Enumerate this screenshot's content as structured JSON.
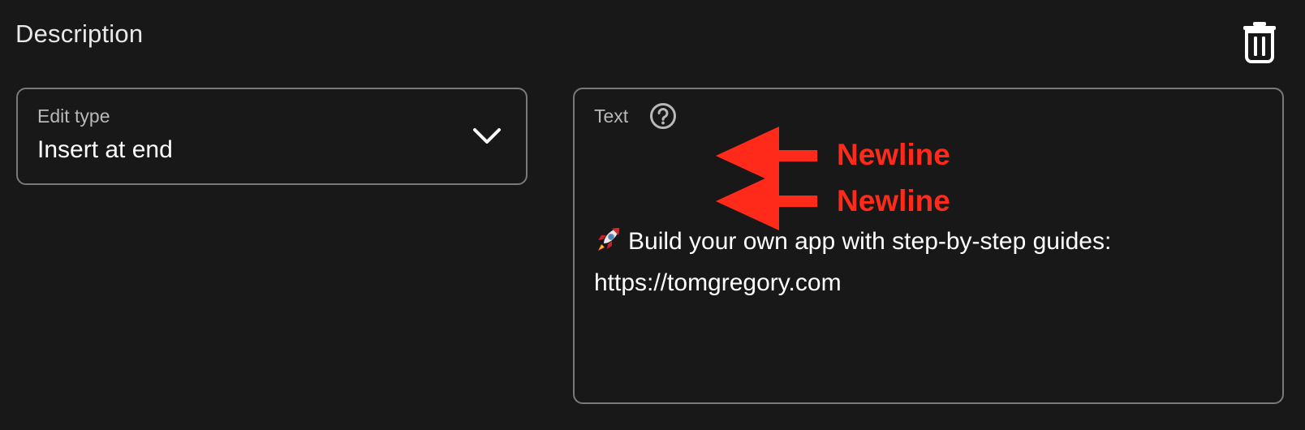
{
  "section": {
    "title": "Description"
  },
  "icons": {
    "delete": "trash-icon",
    "dropdown": "chevron-down-icon",
    "help": "help-circle-icon",
    "emoji": "rocket-icon",
    "annotation_arrow": "arrow-left-icon"
  },
  "edit_type": {
    "label": "Edit type",
    "value": "Insert at end"
  },
  "text_field": {
    "label": "Text",
    "lines": [
      "",
      "",
      "Build your own app with step-by-step guides:",
      "https://tomgregory.com"
    ],
    "emoji": "🚀"
  },
  "annotations": [
    {
      "label": "Newline"
    },
    {
      "label": "Newline"
    }
  ],
  "colors": {
    "background": "#181818",
    "border": "#7a7a7a",
    "label": "#b8b8b8",
    "text": "#ffffff",
    "annotation": "#ff2a1a"
  }
}
